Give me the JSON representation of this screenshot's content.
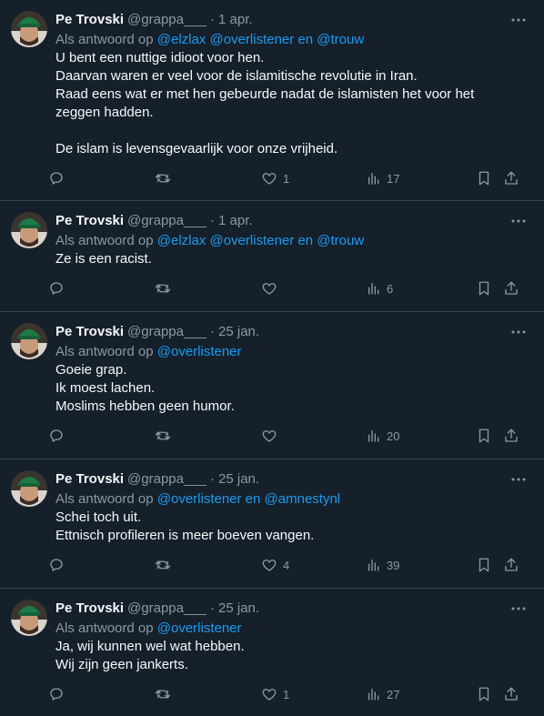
{
  "tweets": [
    {
      "display_name": "Pe Trovski",
      "handle": "@grappa___",
      "date": "1 apr.",
      "reply_prefix": "Als antwoord op",
      "reply_to": "@elzlax @overlistener en @trouw",
      "lines": [
        "U bent een nuttige idioot voor hen.",
        "Daarvan waren er veel voor de islamitische revolutie in Iran.",
        "Raad eens wat er met hen gebeurde nadat de islamisten het voor het",
        "zeggen hadden.",
        "",
        "De islam is levensgevaarlijk voor onze vrijheid."
      ],
      "likes": "1",
      "views": "17"
    },
    {
      "display_name": "Pe Trovski",
      "handle": "@grappa___",
      "date": "1 apr.",
      "reply_prefix": "Als antwoord op",
      "reply_to": "@elzlax @overlistener en @trouw",
      "lines": [
        "Ze is een racist."
      ],
      "likes": "",
      "views": "6"
    },
    {
      "display_name": "Pe Trovski",
      "handle": "@grappa___",
      "date": "25 jan.",
      "reply_prefix": "Als antwoord op",
      "reply_to": "@overlistener",
      "lines": [
        "Goeie grap.",
        "Ik moest lachen.",
        "Moslims hebben geen humor."
      ],
      "likes": "",
      "views": "20"
    },
    {
      "display_name": "Pe Trovski",
      "handle": "@grappa___",
      "date": "25 jan.",
      "reply_prefix": "Als antwoord op",
      "reply_to": "@overlistener en @amnestynl",
      "lines": [
        "Schei toch uit.",
        "Ettnisch profileren is meer boeven vangen."
      ],
      "likes": "4",
      "views": "39"
    },
    {
      "display_name": "Pe Trovski",
      "handle": "@grappa___",
      "date": "25 jan.",
      "reply_prefix": "Als antwoord op",
      "reply_to": "@overlistener",
      "lines": [
        "Ja, wij kunnen wel wat hebben.",
        "Wij zijn geen jankerts."
      ],
      "likes": "1",
      "views": "27"
    }
  ],
  "icons": {
    "more": "more-icon",
    "reply": "reply-icon",
    "retweet": "retweet-icon",
    "like": "heart-icon",
    "views": "views-icon",
    "bookmark": "bookmark-icon",
    "share": "share-icon"
  },
  "colors": {
    "background": "#15202b",
    "text": "#f7f9f9",
    "secondary": "#8b98a5",
    "link": "#1d9bf0",
    "border": "#38444d"
  }
}
